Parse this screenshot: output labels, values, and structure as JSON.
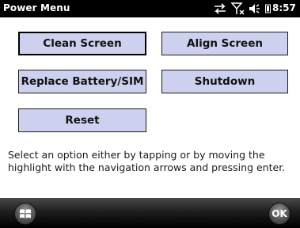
{
  "title_bar": {
    "title": "Power Menu",
    "time": "8:57",
    "status_icons": [
      "connectivity-icon",
      "no-signal-icon",
      "speaker-icon",
      "battery-icon"
    ]
  },
  "buttons": {
    "clean_screen": "Clean Screen",
    "align_screen": "Align Screen",
    "replace_battery": "Replace Battery/SIM",
    "shutdown": "Shutdown",
    "reset": "Reset"
  },
  "instructions": "Select an option either by tapping or by moving the highlight with the navigation arrows and pressing enter.",
  "bottom_bar": {
    "start_icon": "windows-start-icon",
    "ok_label": "OK"
  },
  "colors": {
    "button_fill": "#cdd0ee",
    "title_bar": "#000000"
  }
}
